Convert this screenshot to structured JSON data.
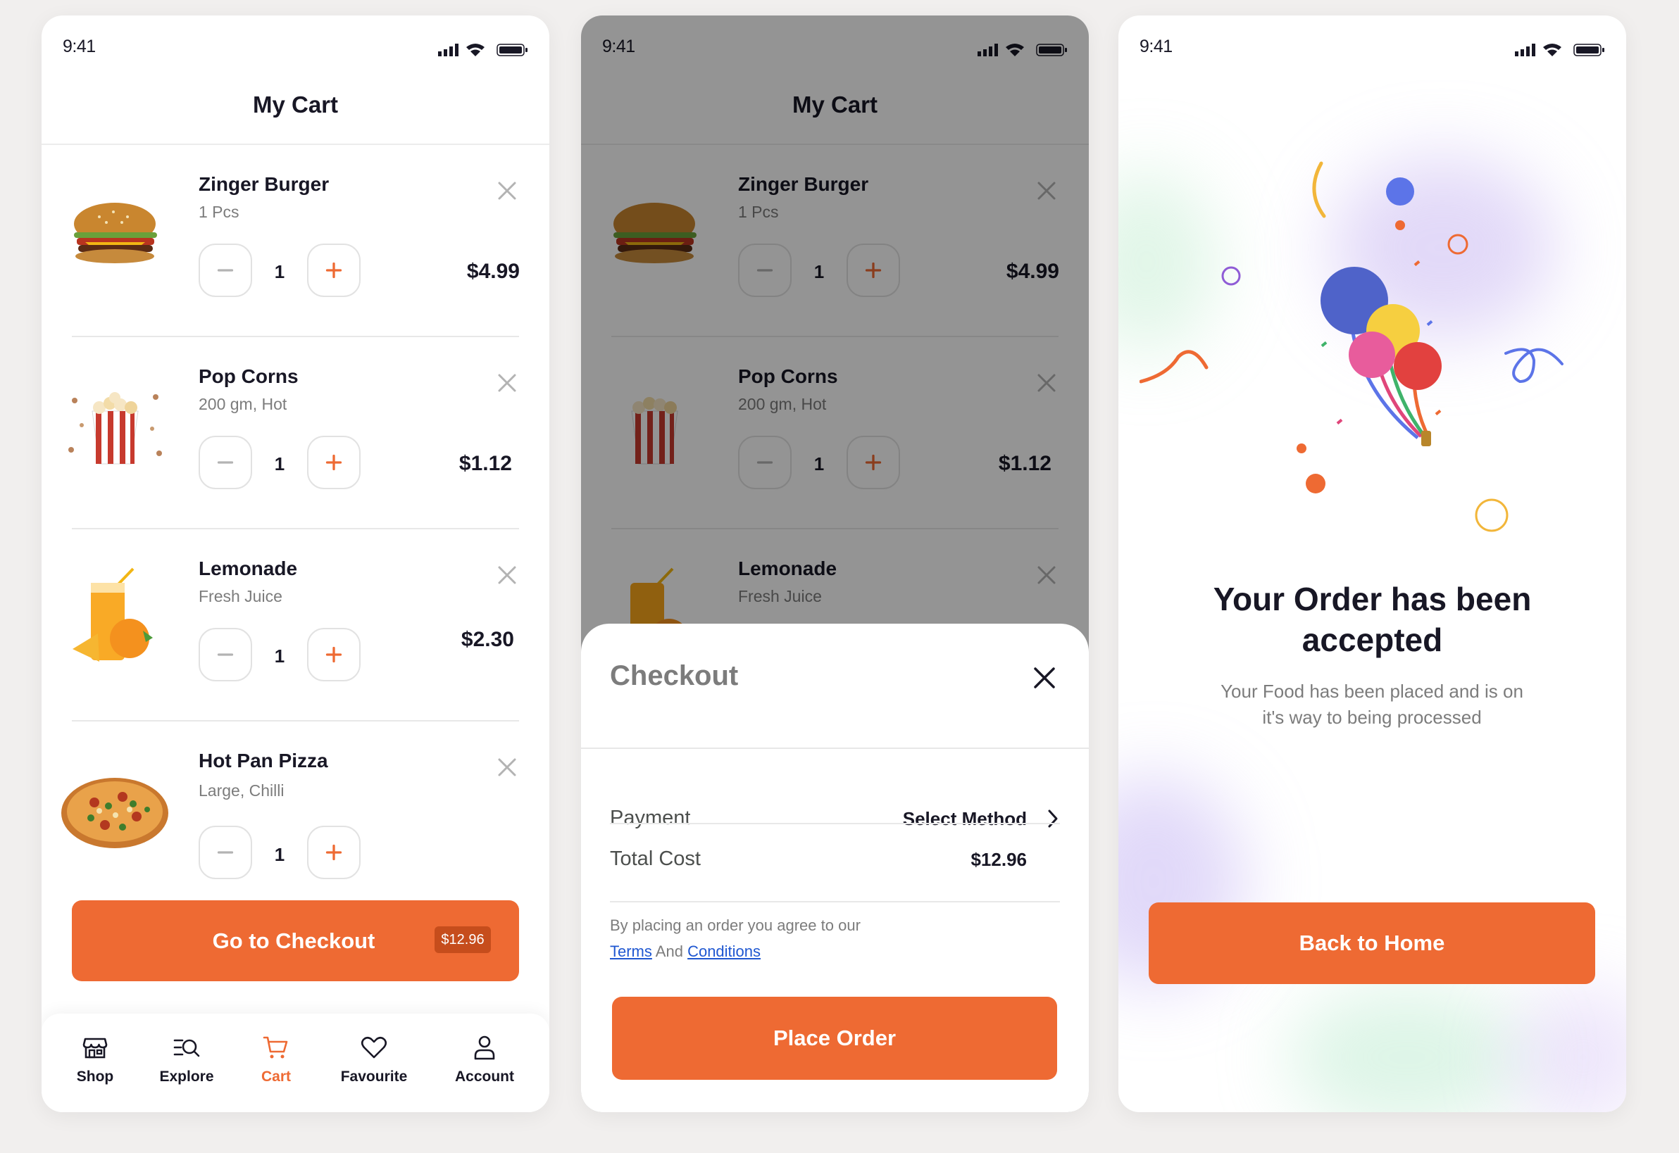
{
  "colors": {
    "accent": "#ee6a33",
    "text": "#181725",
    "muted": "#7c7c7c",
    "link": "#1f57d1"
  },
  "status_time": "9:41",
  "cart": {
    "title": "My Cart",
    "items": [
      {
        "name": "Zinger Burger",
        "desc": "1 Pcs",
        "qty": "1",
        "price": "$4.99"
      },
      {
        "name": "Pop Corns",
        "desc": "200 gm, Hot",
        "qty": "1",
        "price": "$1.12"
      },
      {
        "name": "Lemonade",
        "desc": "Fresh Juice",
        "qty": "1",
        "price": "$2.30"
      },
      {
        "name": "Hot Pan Pizza",
        "desc": "Large, Chilli",
        "qty": "1",
        "price": ""
      }
    ],
    "checkout_label": "Go to Checkout",
    "checkout_total": "$12.96"
  },
  "nav": [
    {
      "label": "Shop",
      "icon": "store-icon"
    },
    {
      "label": "Explore",
      "icon": "explore-icon"
    },
    {
      "label": "Cart",
      "icon": "cart-icon",
      "active": true
    },
    {
      "label": "Favourite",
      "icon": "heart-icon"
    },
    {
      "label": "Account",
      "icon": "user-icon"
    }
  ],
  "checkout": {
    "title": "Checkout",
    "payment_label": "Payment",
    "payment_value": "Select Method",
    "total_label": "Total Cost",
    "total_value": "$12.96",
    "terms_prefix": "By placing an order you agree to our",
    "terms_link": "Terms",
    "terms_and": "And",
    "conditions_link": "Conditions",
    "place_order": "Place Order"
  },
  "success": {
    "title_line1": "Your Order has been",
    "title_line2": "accepted",
    "subtitle_line1": "Your Food has been placed and is on",
    "subtitle_line2": "it's way to being processed",
    "back_home": "Back to Home"
  }
}
